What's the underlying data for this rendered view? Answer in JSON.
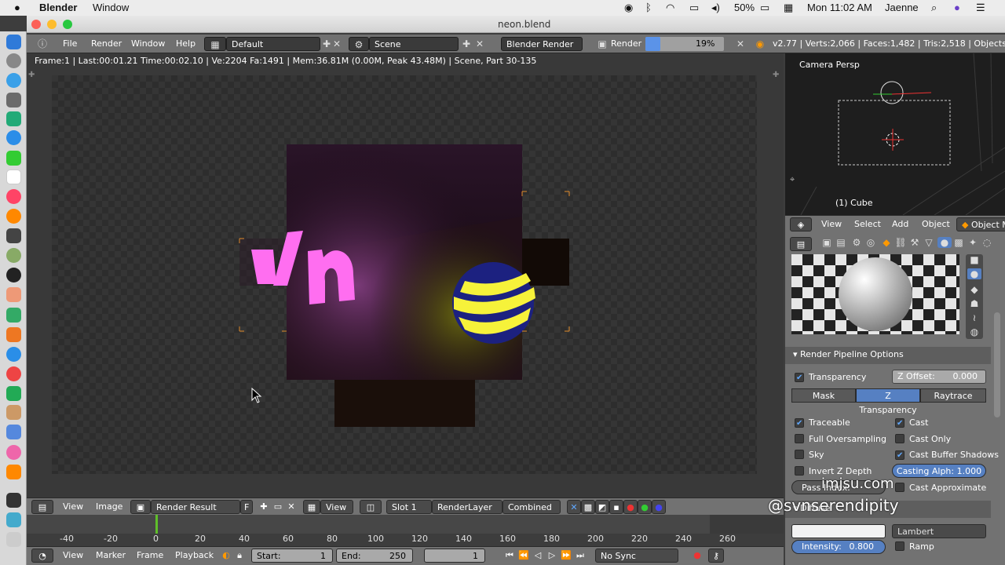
{
  "macbar": {
    "app": "Blender",
    "menu": "Window",
    "battery": "50%",
    "clock": "Mon 11:02 AM",
    "user": "Jaenne"
  },
  "window": {
    "title": "neon.blend"
  },
  "info": {
    "menus": [
      "File",
      "Render",
      "Window",
      "Help"
    ],
    "layout": "Default",
    "scene": "Scene",
    "engine": "Blender Render",
    "render_label": "Render",
    "progress_text": "19%",
    "progress": 0.19,
    "stats": "v2.77 | Verts:2,066 | Faces:1,482 | Tris:2,518 | Objects:1/4 | L"
  },
  "image_editor": {
    "status": "Frame:1 | Last:00:01.21 Time:00:02.10 | Ve:2204 Fa:1491 | Mem:36.81M (0.00M, Peak 43.48M) | Scene, Part 30-135"
  },
  "editor_header": {
    "view": "View",
    "image": "Image",
    "image_name": "Render Result",
    "fake": "F",
    "view2": "View",
    "slot": "Slot 1",
    "layer": "RenderLayer",
    "pass": "Combined"
  },
  "timeline": {
    "ticks": [
      "-40",
      "-20",
      "0",
      "20",
      "40",
      "60",
      "80",
      "100",
      "120",
      "140",
      "160",
      "180",
      "200",
      "220",
      "240",
      "260"
    ],
    "menus": [
      "View",
      "Marker",
      "Frame",
      "Playback"
    ],
    "start_label": "Start:",
    "start": "1",
    "end_label": "End:",
    "end": "250",
    "current": "1",
    "sync": "No Sync"
  },
  "view3d": {
    "title": "Camera Persp",
    "object": "(1) Cube",
    "menus": [
      "View",
      "Select",
      "Add",
      "Object"
    ],
    "mode": "Object M"
  },
  "props": {
    "panel": "Render Pipeline Options",
    "transparency": "Transparency",
    "z_offset": "Z Offset:",
    "z_offset_val": "0.000",
    "modes": [
      "Mask",
      "Z Transparency",
      "Raytrace"
    ],
    "left_opts": [
      {
        "label": "Traceable",
        "on": true
      },
      {
        "label": "Full Oversampling",
        "on": false
      },
      {
        "label": "Sky",
        "on": false
      },
      {
        "label": "Invert Z Depth",
        "on": false
      }
    ],
    "right_opts": [
      {
        "label": "Cast",
        "on": true
      },
      {
        "label": "Cast Only",
        "on": false
      },
      {
        "label": "Cast Buffer Shadows",
        "on": true
      }
    ],
    "casting_alpha": "Casting Alph: 1.000",
    "pass_index": "Pass Index:",
    "cast_approx": "Cast Approximate",
    "diffuse": "Diffuse",
    "shader": "Lambert",
    "intensity_label": "Intensity:",
    "intensity": "0.800",
    "ramp": "Ramp"
  },
  "watermark": {
    "line1": "imjsu.com",
    "line2": "@svnserendipity"
  },
  "colors": {
    "accent": "#5680c2",
    "neon": "#ff66ee",
    "ball_blue": "#1a1f7a",
    "ball_yellow": "#f5f23a"
  }
}
